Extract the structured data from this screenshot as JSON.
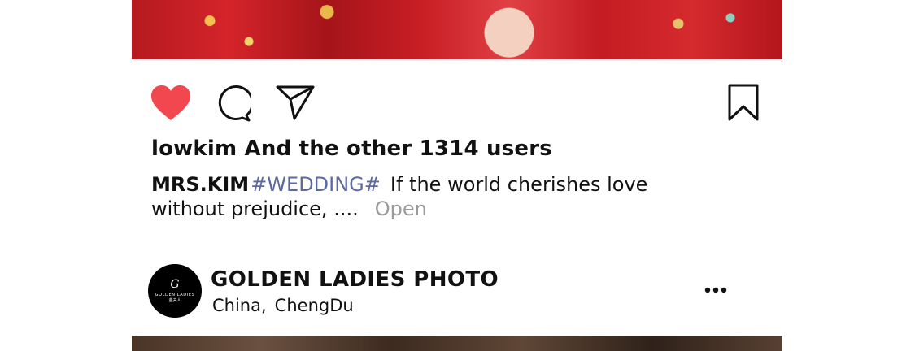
{
  "post": {
    "likes_text": "lowkim And the other 1314 users",
    "caption": {
      "username": "MRS.KIM",
      "hashtag": "#WEDDING#",
      "text": "If the world cherishes love without prejudice, ....",
      "open_label": "Open"
    },
    "actions": {
      "like_icon": "heart-icon",
      "comment_icon": "comment-icon",
      "share_icon": "send-icon",
      "save_icon": "bookmark-icon",
      "liked": true,
      "like_color": "#f2474f"
    }
  },
  "next_post": {
    "account_name": "GOLDEN LADIES PHOTO",
    "location_country": "China,",
    "location_city": "ChengDu",
    "avatar": {
      "monogram": "G",
      "line1": "GOLDEN LADIES",
      "line2": "金夫人"
    },
    "more_icon": "more-dots-icon"
  },
  "colors": {
    "hashtag": "#5d6aa0",
    "open": "#9a9a9a",
    "text": "#111111"
  }
}
